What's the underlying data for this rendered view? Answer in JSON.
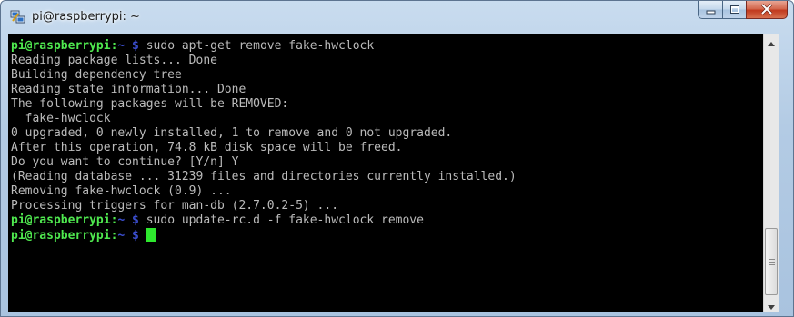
{
  "window": {
    "title": "pi@raspberrypi: ~",
    "icon": "putty-icon",
    "controls": [
      "minimize-icon",
      "maximize-icon",
      "close-icon"
    ]
  },
  "colors": {
    "terminal_bg": "#000000",
    "terminal_text": "#bbbbbb",
    "prompt_user": "#4fe84f",
    "prompt_path": "#3b4ecf",
    "cursor": "#2ee82e",
    "close_button": "#c0391d"
  },
  "prompt": {
    "user_host": "pi@raspberrypi",
    "separator": ":",
    "path": "~ $"
  },
  "terminal": {
    "lines": [
      {
        "type": "prompt",
        "command": " sudo apt-get remove fake-hwclock"
      },
      {
        "type": "output",
        "text": "Reading package lists... Done"
      },
      {
        "type": "output",
        "text": "Building dependency tree"
      },
      {
        "type": "output",
        "text": "Reading state information... Done"
      },
      {
        "type": "output",
        "text": "The following packages will be REMOVED:"
      },
      {
        "type": "output",
        "text": "  fake-hwclock"
      },
      {
        "type": "output",
        "text": "0 upgraded, 0 newly installed, 1 to remove and 0 not upgraded."
      },
      {
        "type": "output",
        "text": "After this operation, 74.8 kB disk space will be freed."
      },
      {
        "type": "output",
        "text": "Do you want to continue? [Y/n] Y"
      },
      {
        "type": "output",
        "text": "(Reading database ... 31239 files and directories currently installed.)"
      },
      {
        "type": "output",
        "text": "Removing fake-hwclock (0.9) ..."
      },
      {
        "type": "output",
        "text": "Processing triggers for man-db (2.7.0.2-5) ..."
      },
      {
        "type": "prompt",
        "command": " sudo update-rc.d -f fake-hwclock remove"
      },
      {
        "type": "prompt",
        "command": " ",
        "cursor": true
      }
    ]
  },
  "scrollbar": {
    "up_icon": "arrow-up-icon",
    "down_icon": "arrow-down-icon",
    "position": 1.0
  }
}
